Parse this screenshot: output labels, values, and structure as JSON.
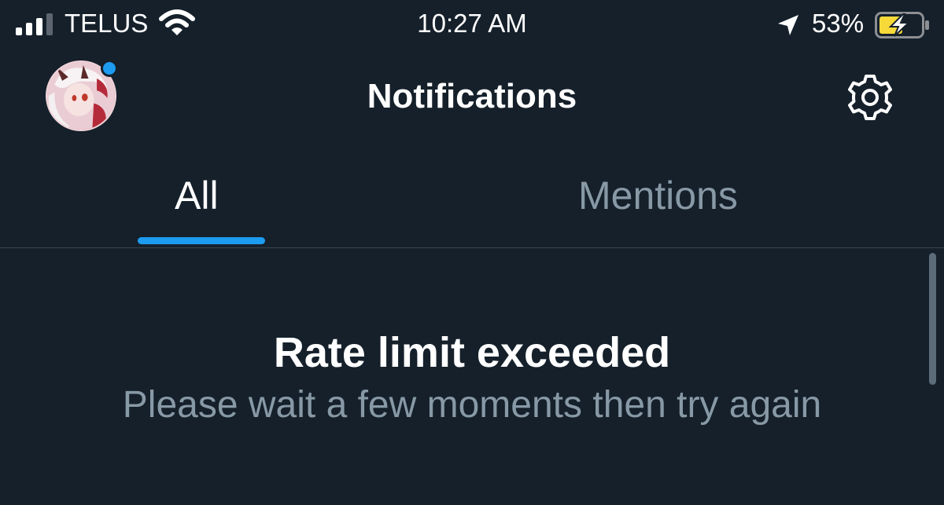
{
  "status_bar": {
    "carrier": "TELUS",
    "time": "10:27 AM",
    "battery_percent": "53%",
    "icons": [
      "signal-icon",
      "wifi-icon",
      "location-arrow-icon",
      "battery-charging-icon"
    ]
  },
  "header": {
    "title": "Notifications",
    "avatar_icon": "profile-avatar",
    "settings_icon": "gear-icon"
  },
  "tabs": [
    {
      "label": "All",
      "selected": true
    },
    {
      "label": "Mentions",
      "selected": false
    }
  ],
  "message": {
    "title": "Rate limit exceeded",
    "subtitle": "Please wait a few moments then try again"
  },
  "colors": {
    "background": "#15202b",
    "accent": "#1d9bf0",
    "muted_text": "#8899a6",
    "battery_charge": "#f7d93a"
  }
}
